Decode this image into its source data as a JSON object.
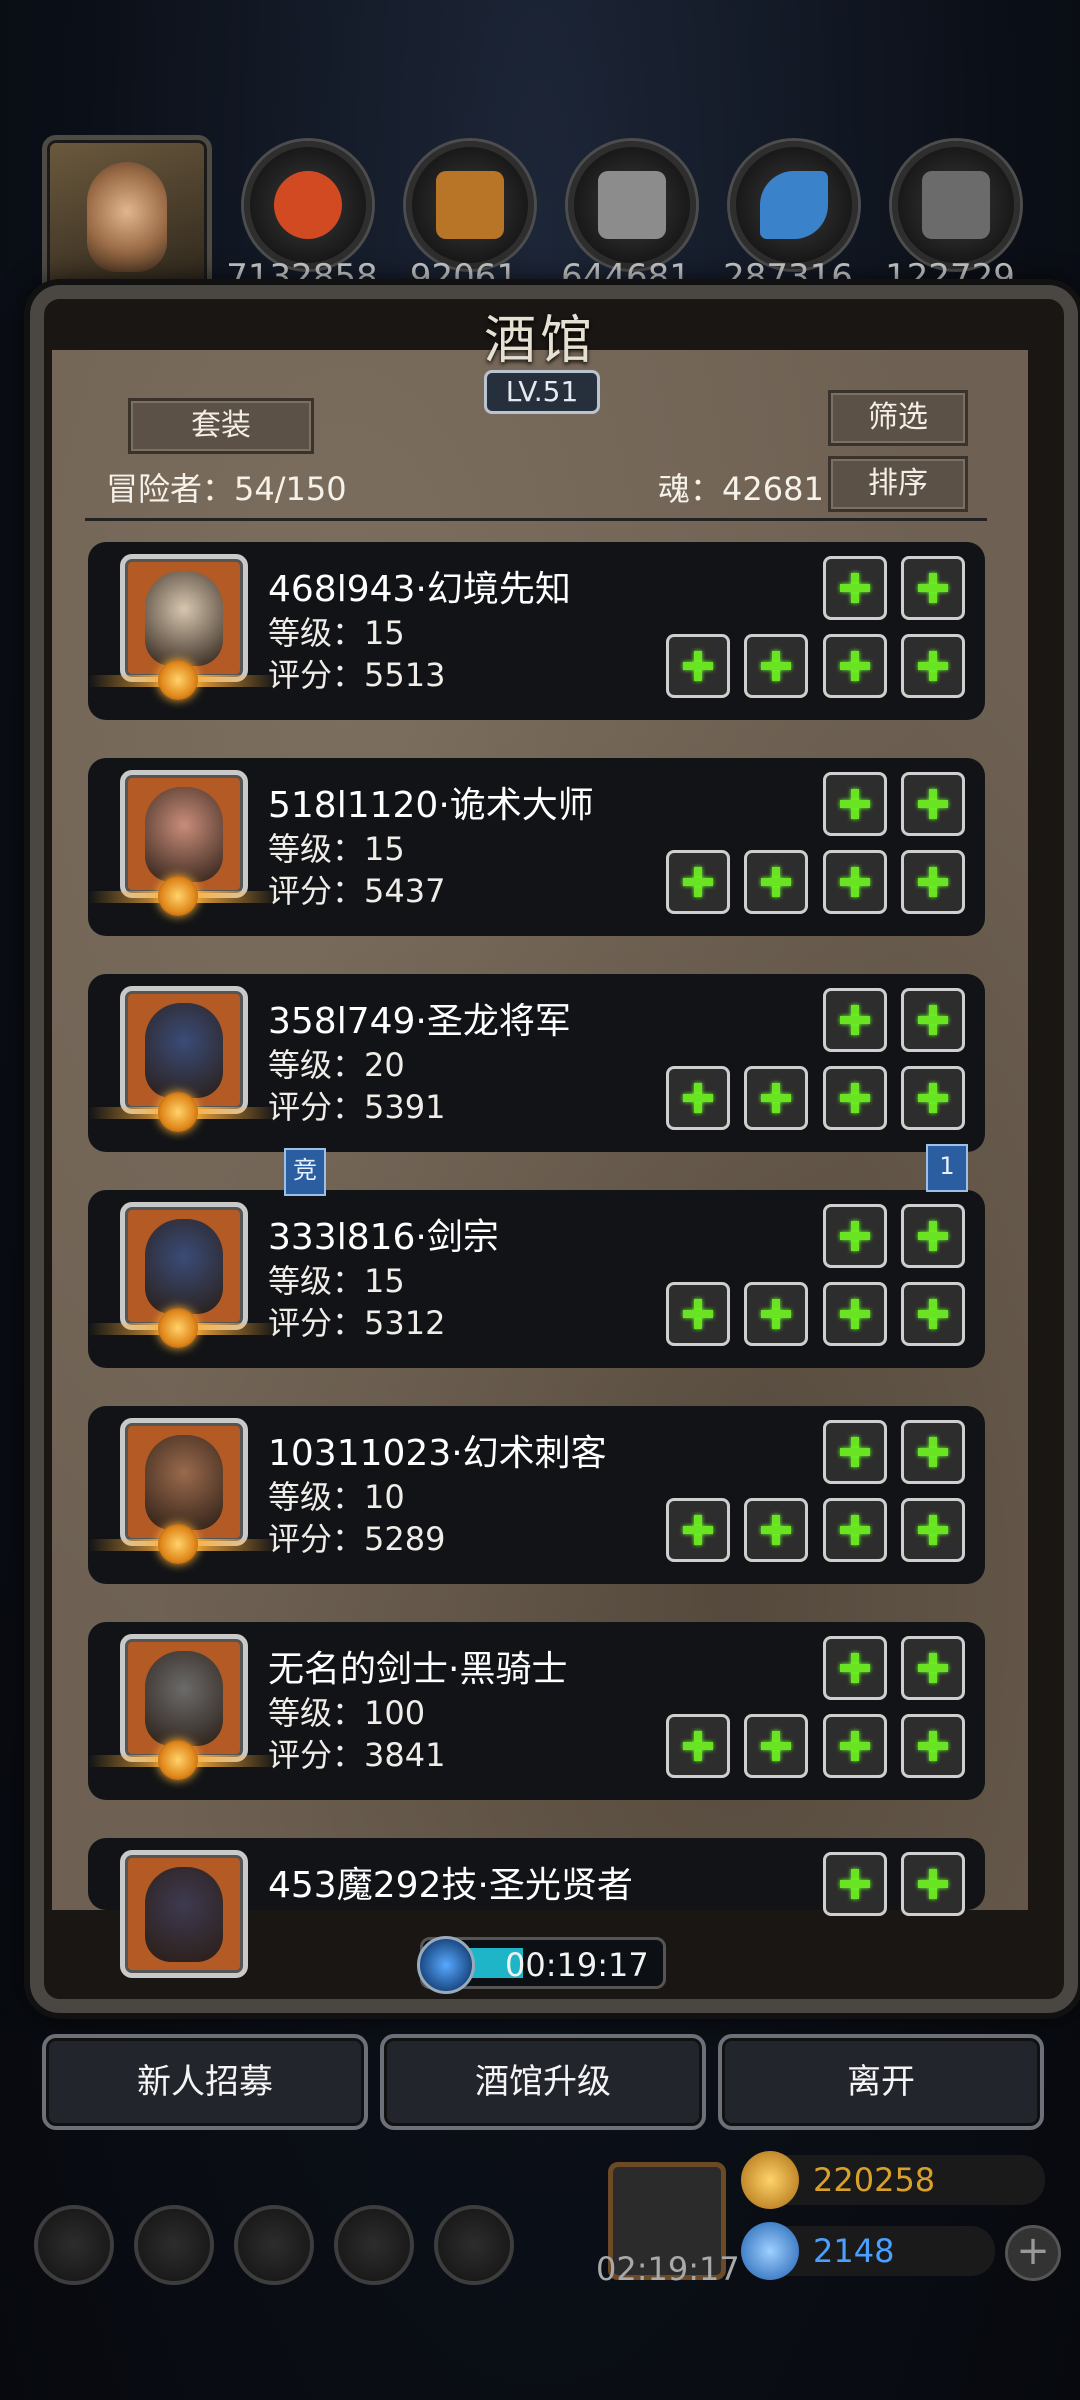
{
  "resources": {
    "values": [
      "7132858",
      "92061",
      "644681",
      "287316",
      "122729"
    ],
    "colors": [
      "#d24a22",
      "#b87427",
      "#8c8c8c",
      "#3a82c9",
      "#6b6b6b"
    ]
  },
  "panel": {
    "title": "酒馆",
    "level": "LV.51",
    "outfit_button": "套装",
    "filter_button": "筛选",
    "sort_button": "排序",
    "adventurers_label": "冒险者：54/150",
    "soul_label": "魂：42681"
  },
  "heroes": [
    {
      "name": "468l943·幻境先知",
      "level": "等级：15",
      "score": "评分：5513",
      "bg": "#b35a25",
      "face": "#d7c7b0"
    },
    {
      "name": "518l1120·诡术大师",
      "level": "等级：15",
      "score": "评分：5437",
      "bg": "#b35a25",
      "face": "#c98d7a"
    },
    {
      "name": "358l749·圣龙将军",
      "level": "等级：20",
      "score": "评分：5391",
      "bg": "#b35a25",
      "face": "#3a4c78"
    },
    {
      "name": "333l816·剑宗",
      "level": "等级：15",
      "score": "评分：5312",
      "bg": "#b35a25",
      "face": "#3a4c78"
    },
    {
      "name": "10311023·幻术刺客",
      "level": "等级：10",
      "score": "评分：5289",
      "bg": "#b35a25",
      "face": "#9a6a4c"
    },
    {
      "name": "无名的剑士·黑骑士",
      "level": "等级：100",
      "score": "评分：3841",
      "bg": "#b35a25",
      "face": "#6b6b6b"
    },
    {
      "name": "453魔292技·圣光贤者",
      "level": "",
      "score": "",
      "bg": "#b35a25",
      "face": "#3e3a50"
    }
  ],
  "tags": {
    "left": "竞",
    "right": "1"
  },
  "timer": "00:19:17",
  "actions": {
    "recruit": "新人招募",
    "upgrade": "酒馆升级",
    "leave": "离开"
  },
  "hud": {
    "gift_timer": "02:19:17",
    "gold": "220258",
    "gems": "2148",
    "gold_color": "#d9a12a",
    "gem_color": "#4aa0ff"
  }
}
